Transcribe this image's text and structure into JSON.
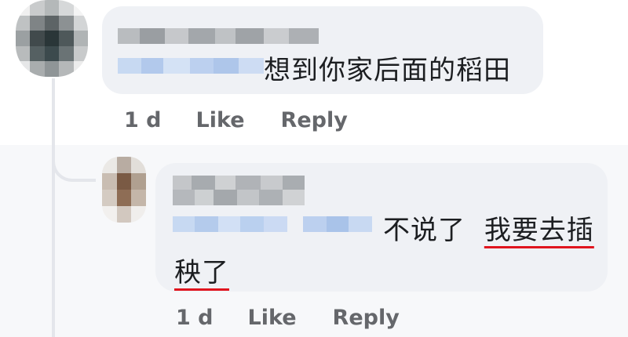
{
  "comments": [
    {
      "text": "想到你家后面的稻田",
      "time": "1 d",
      "like_label": "Like",
      "reply_label": "Reply"
    },
    {
      "text_plain": "不说了",
      "text_underlined_1": "我要去插",
      "text_underlined_2": "秧了",
      "time": "1 d",
      "like_label": "Like",
      "reply_label": "Reply"
    }
  ],
  "colors": {
    "bubble_bg": "#eff1f5",
    "action_text": "#65676b",
    "underline": "#e0141e",
    "thread_line": "#e4e6eb"
  }
}
